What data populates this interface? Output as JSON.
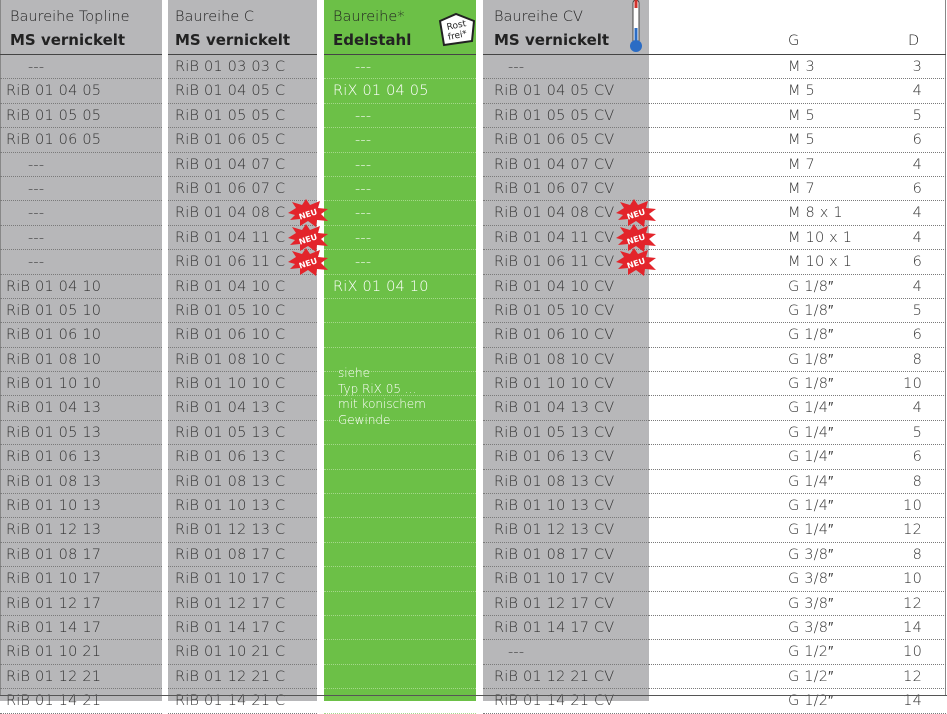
{
  "headers": {
    "topline": {
      "series": "Baureihe Topline",
      "material": "MS vernickelt"
    },
    "c": {
      "series": "Baureihe C",
      "material": "MS vernickelt"
    },
    "edelstahl": {
      "series": "Baureihe*",
      "material": "Edelstahl"
    },
    "cv": {
      "series": "Baureihe CV",
      "material": "MS vernickelt"
    },
    "g": "G",
    "d": "D"
  },
  "badges": {
    "rostfrei_line1": "Rost",
    "rostfrei_line2": "frei*",
    "neu_label": "NEU"
  },
  "note": [
    "siehe",
    "Typ RiX 05 ...",
    "mit konischem",
    "Gewinde"
  ],
  "rows": [
    {
      "topline": "---",
      "c": "RiB 01 03 03 C",
      "edelstahl": "---",
      "cv": "---",
      "g": "M 3",
      "d": "3",
      "neu": false
    },
    {
      "topline": "RiB 01 04 05",
      "c": "RiB 01 04 05 C",
      "edelstahl": "RiX 01 04 05",
      "cv": "RiB 01 04 05 CV",
      "g": "M 5",
      "d": "4",
      "neu": false
    },
    {
      "topline": "RiB 01 05 05",
      "c": "RiB 01 05 05 C",
      "edelstahl": "---",
      "cv": "RiB 01 05 05 CV",
      "g": "M 5",
      "d": "5",
      "neu": false
    },
    {
      "topline": "RiB 01 06 05",
      "c": "RiB 01 06 05 C",
      "edelstahl": "---",
      "cv": "RiB 01 06 05 CV",
      "g": "M 5",
      "d": "6",
      "neu": false
    },
    {
      "topline": "---",
      "c": "RiB 01 04 07 C",
      "edelstahl": "---",
      "cv": "RiB 01 04 07 CV",
      "g": "M 7",
      "d": "4",
      "neu": false
    },
    {
      "topline": "---",
      "c": "RiB 01 06 07 C",
      "edelstahl": "---",
      "cv": "RiB 01 06 07 CV",
      "g": "M 7",
      "d": "6",
      "neu": false
    },
    {
      "topline": "---",
      "c": "RiB 01 04 08 C",
      "edelstahl": "---",
      "cv": "RiB 01 04 08 CV",
      "g": "M 8 x 1",
      "d": "4",
      "neu": true
    },
    {
      "topline": "---",
      "c": "RiB 01 04 11 C",
      "edelstahl": "---",
      "cv": "RiB 01 04 11 CV",
      "g": "M 10 x 1",
      "d": "4",
      "neu": true
    },
    {
      "topline": "---",
      "c": "RiB 01 06 11 C",
      "edelstahl": "---",
      "cv": "RiB 01 06 11 CV",
      "g": "M 10 x 1",
      "d": "6",
      "neu": true
    },
    {
      "topline": "RiB 01 04 10",
      "c": "RiB 01 04 10 C",
      "edelstahl": "RiX 01 04 10",
      "cv": "RiB 01 04 10 CV",
      "g": "G 1/8″",
      "d": "4",
      "neu": false
    },
    {
      "topline": "RiB 01 05 10",
      "c": "RiB 01 05 10 C",
      "edelstahl": "",
      "cv": "RiB 01 05 10 CV",
      "g": "G 1/8″",
      "d": "5",
      "neu": false
    },
    {
      "topline": "RiB 01 06 10",
      "c": "RiB 01 06 10 C",
      "edelstahl": "",
      "cv": "RiB 01 06 10 CV",
      "g": "G 1/8″",
      "d": "6",
      "neu": false
    },
    {
      "topline": "RiB 01 08 10",
      "c": "RiB 01 08 10 C",
      "edelstahl": "",
      "cv": "RiB 01 08 10 CV",
      "g": "G 1/8″",
      "d": "8",
      "neu": false
    },
    {
      "topline": "RiB 01 10 10",
      "c": "RiB 01 10 10 C",
      "edelstahl": "",
      "cv": "RiB 01 10 10 CV",
      "g": "G 1/8″",
      "d": "10",
      "neu": false
    },
    {
      "topline": "RiB 01 04 13",
      "c": "RiB 01 04 13 C",
      "edelstahl": "",
      "cv": "RiB 01 04 13 CV",
      "g": "G 1/4″",
      "d": "4",
      "neu": false
    },
    {
      "topline": "RiB 01 05 13",
      "c": "RiB 01 05 13 C",
      "edelstahl": "",
      "cv": "RiB 01 05 13 CV",
      "g": "G 1/4″",
      "d": "5",
      "neu": false
    },
    {
      "topline": "RiB 01 06 13",
      "c": "RiB 01 06 13 C",
      "edelstahl": "",
      "cv": "RiB 01 06 13 CV",
      "g": "G 1/4″",
      "d": "6",
      "neu": false
    },
    {
      "topline": "RiB 01 08 13",
      "c": "RiB 01 08 13 C",
      "edelstahl": "",
      "cv": "RiB 01 08 13 CV",
      "g": "G 1/4″",
      "d": "8",
      "neu": false
    },
    {
      "topline": "RiB 01 10 13",
      "c": "RiB 01 10 13 C",
      "edelstahl": "",
      "cv": "RiB 01 10 13 CV",
      "g": "G 1/4″",
      "d": "10",
      "neu": false
    },
    {
      "topline": "RiB 01 12 13",
      "c": "RiB 01 12 13 C",
      "edelstahl": "",
      "cv": "RiB 01 12 13 CV",
      "g": "G 1/4″",
      "d": "12",
      "neu": false
    },
    {
      "topline": "RiB 01 08 17",
      "c": "RiB 01 08 17 C",
      "edelstahl": "",
      "cv": "RiB 01 08 17 CV",
      "g": "G 3/8″",
      "d": "8",
      "neu": false
    },
    {
      "topline": "RiB 01 10 17",
      "c": "RiB 01 10 17 C",
      "edelstahl": "",
      "cv": "RiB 01 10 17 CV",
      "g": "G 3/8″",
      "d": "10",
      "neu": false
    },
    {
      "topline": "RiB 01 12 17",
      "c": "RiB 01 12 17 C",
      "edelstahl": "",
      "cv": "RiB 01 12 17 CV",
      "g": "G 3/8″",
      "d": "12",
      "neu": false
    },
    {
      "topline": "RiB 01 14 17",
      "c": "RiB 01 14 17 C",
      "edelstahl": "",
      "cv": "RiB 01 14 17 CV",
      "g": "G 3/8″",
      "d": "14",
      "neu": false
    },
    {
      "topline": "RiB 01 10 21",
      "c": "RiB 01 10 21 C",
      "edelstahl": "",
      "cv": "---",
      "g": "G 1/2″",
      "d": "10",
      "neu": false
    },
    {
      "topline": "RiB 01 12 21",
      "c": "RiB 01 12 21 C",
      "edelstahl": "",
      "cv": "RiB 01 12 21 CV",
      "g": "G 1/2″",
      "d": "12",
      "neu": false
    },
    {
      "topline": "RiB 01 14 21",
      "c": "RiB 01 14 21 C",
      "edelstahl": "",
      "cv": "RiB 01 14 21 CV",
      "g": "G 1/2″",
      "d": "14",
      "neu": false
    }
  ],
  "colors": {
    "gray_band": "#b7b7b9",
    "green_band": "#6cc047",
    "neu_red": "#e3242b"
  }
}
